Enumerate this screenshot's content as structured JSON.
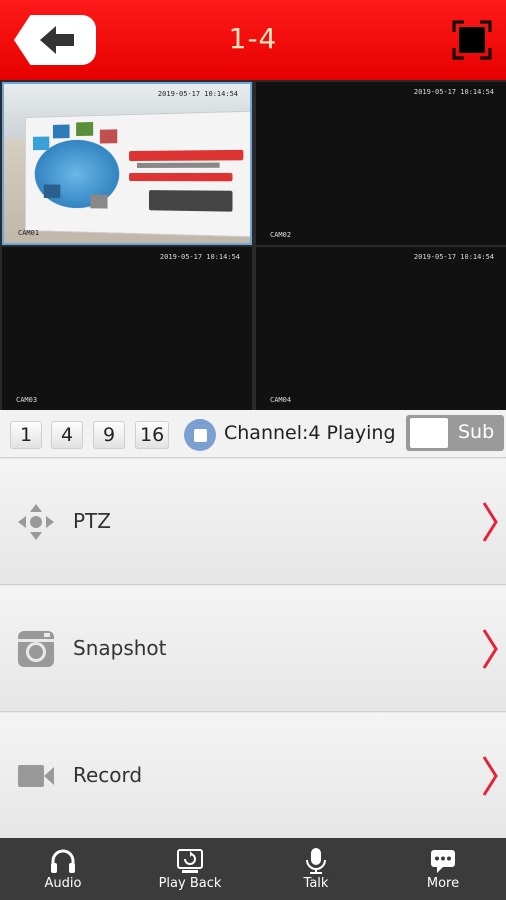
{
  "header": {
    "title": "1-4",
    "back_icon": "arrow-left-icon",
    "fullscreen_icon": "fullscreen-icon",
    "accent": "#ff0000"
  },
  "cameras": [
    {
      "timestamp": "2019-05-17 10:14:54",
      "name": "CAM01"
    },
    {
      "timestamp": "2019-05-17 10:14:54",
      "name": "CAM02"
    },
    {
      "timestamp": "2019-05-17 10:14:54",
      "name": "CAM03"
    },
    {
      "timestamp": "2019-05-17 10:14:54",
      "name": "CAM04"
    }
  ],
  "layout_buttons": [
    "1",
    "4",
    "9",
    "16"
  ],
  "status": {
    "text": "Channel:4 Playing"
  },
  "stream_toggle": {
    "label": "Sub"
  },
  "menu": [
    {
      "label": "PTZ",
      "icon": "ptz-directional-icon"
    },
    {
      "label": "Snapshot",
      "icon": "camera-icon"
    },
    {
      "label": "Record",
      "icon": "video-camera-icon"
    }
  ],
  "bottom_tabs": [
    {
      "label": "Audio",
      "icon": "headphones-icon"
    },
    {
      "label": "Play Back",
      "icon": "playback-icon"
    },
    {
      "label": "Talk",
      "icon": "microphone-icon"
    },
    {
      "label": "More",
      "icon": "chat-bubble-icon"
    }
  ]
}
